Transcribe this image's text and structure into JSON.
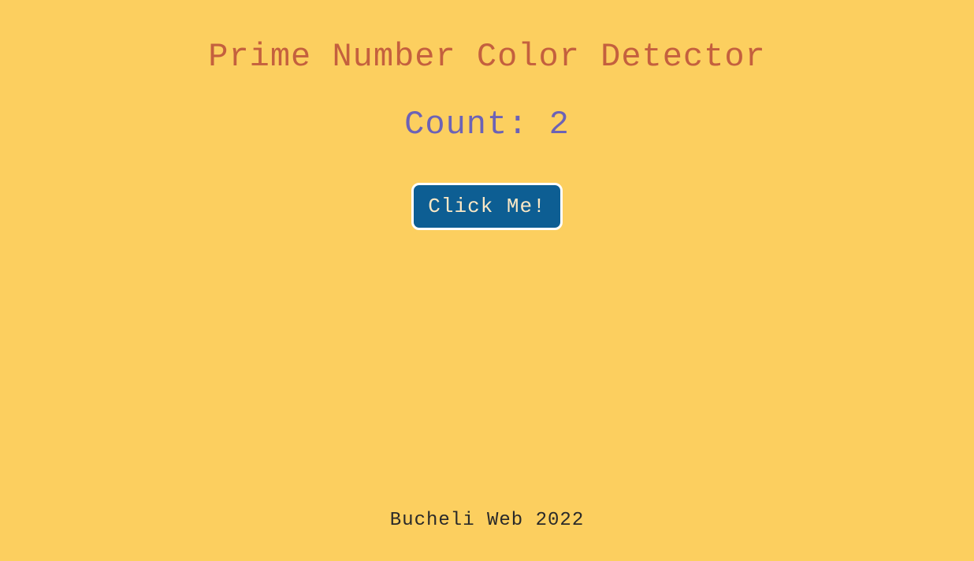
{
  "title": "Prime Number Color Detector",
  "count_label": "Count: ",
  "count_value": "2",
  "button_label": "Click Me!",
  "footer": "Bucheli Web 2022"
}
